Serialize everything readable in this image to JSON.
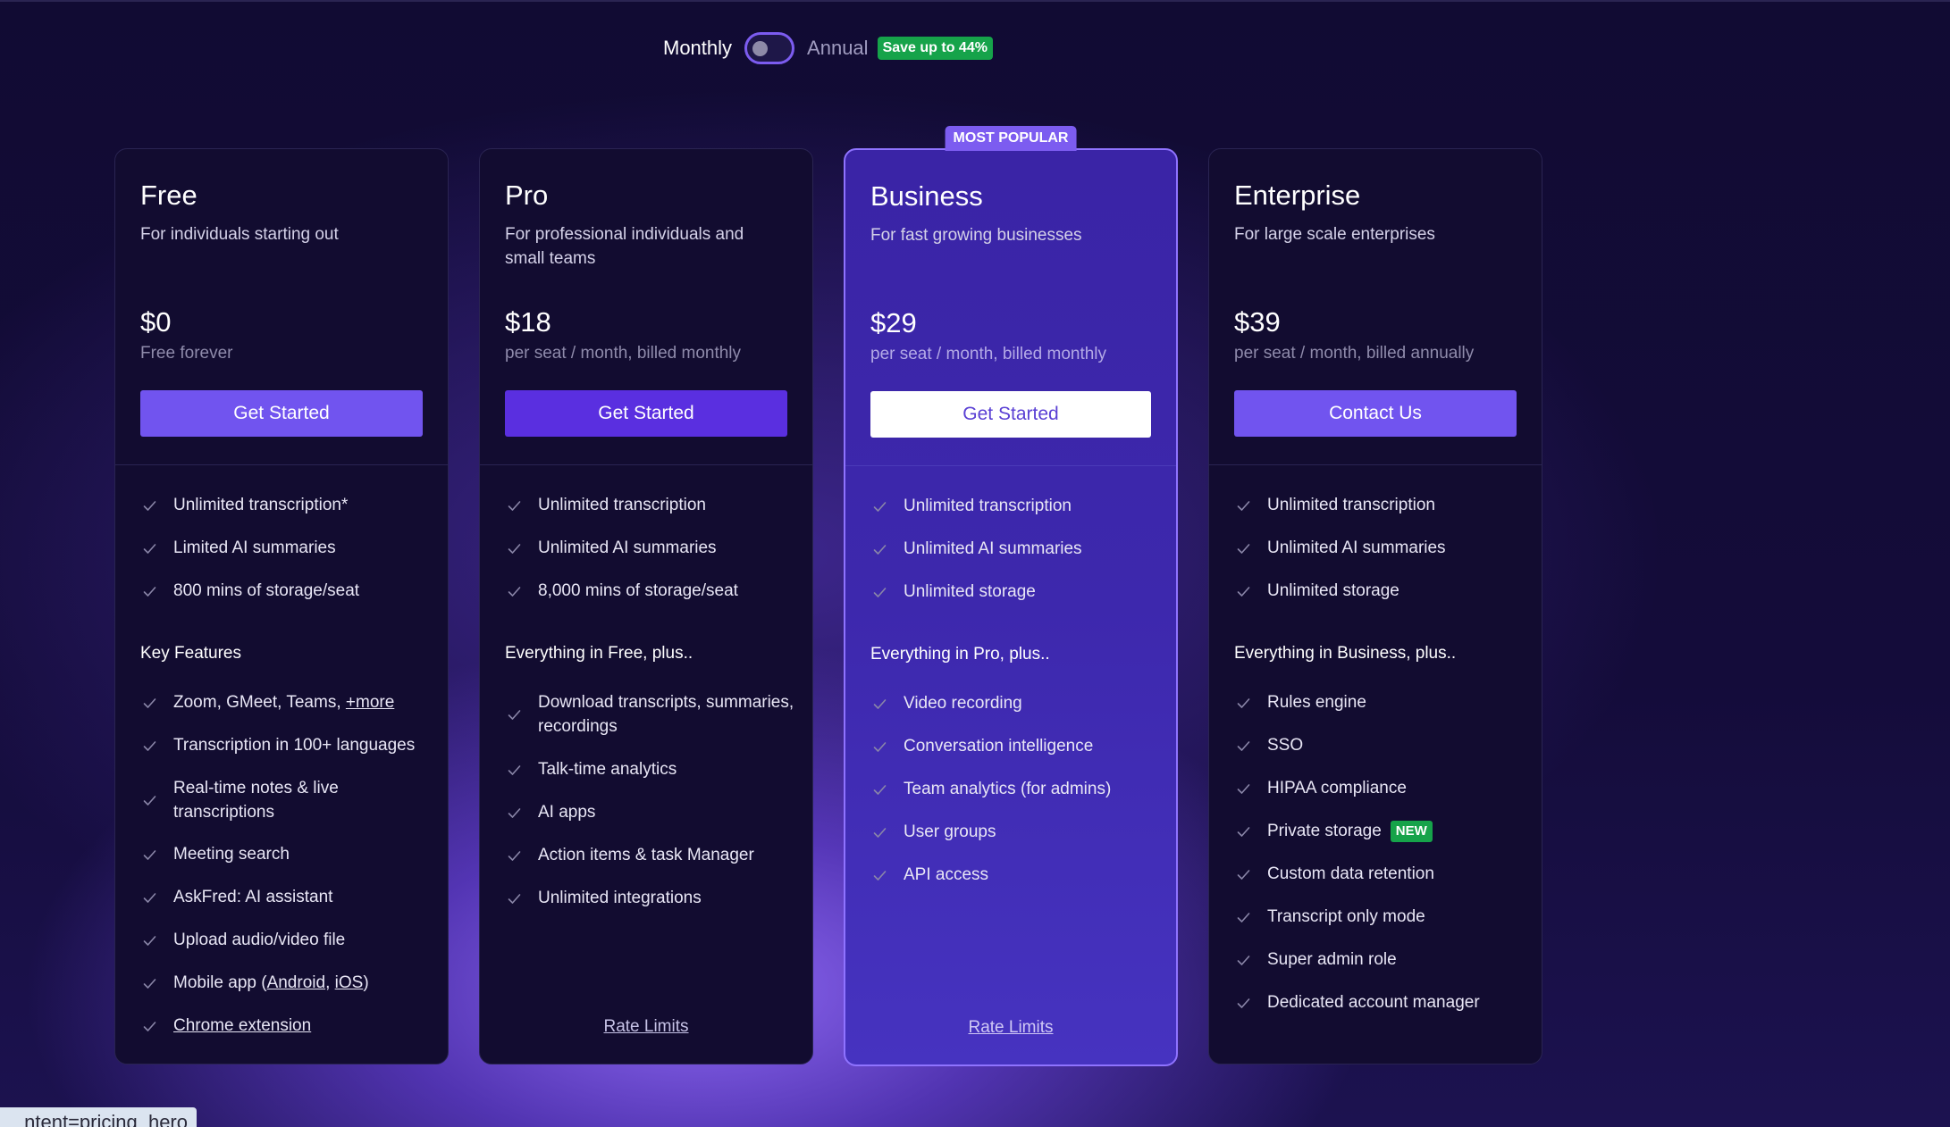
{
  "billing": {
    "monthly_label": "Monthly",
    "annual_label": "Annual",
    "save_badge": "Save up to 44%",
    "selected": "Monthly"
  },
  "plans": [
    {
      "name": "Free",
      "tagline": "For individuals starting out",
      "price": "$0",
      "period": "Free forever",
      "cta": "Get Started",
      "core": [
        "Unlimited transcription*",
        "Limited AI summaries",
        "800 mins of storage/seat"
      ],
      "group_title": "Key Features",
      "features": [
        "Zoom, GMeet, Teams, ",
        "Transcription in 100+ languages",
        "Real-time notes & live transcriptions",
        "Meeting search",
        "AskFred: AI assistant",
        "Upload audio/video file",
        "Mobile app (",
        ""
      ],
      "more_link": "+more",
      "android_link": "Android",
      "ios_link": "iOS",
      "mobile_sep": ", ",
      "mobile_close": ")",
      "chrome_link": "Chrome extension"
    },
    {
      "name": "Pro",
      "tagline": "For professional individuals and small teams",
      "price": "$18",
      "period": "per seat / month, billed monthly",
      "cta": "Get Started",
      "core": [
        "Unlimited transcription",
        "Unlimited AI summaries",
        "8,000 mins of storage/seat"
      ],
      "group_title": "Everything in Free, plus..",
      "features": [
        "Download transcripts, summaries, recordings",
        "Talk-time analytics",
        "AI apps",
        "Action items & task Manager",
        "Unlimited integrations"
      ],
      "footer_link": "Rate Limits"
    },
    {
      "name": "Business",
      "badge": "MOST POPULAR",
      "tagline": "For fast growing businesses",
      "price": "$29",
      "period": "per seat / month, billed monthly",
      "cta": "Get Started",
      "core": [
        "Unlimited transcription",
        "Unlimited AI summaries",
        "Unlimited storage"
      ],
      "group_title": "Everything in Pro, plus..",
      "features": [
        "Video recording",
        "Conversation intelligence",
        "Team analytics (for admins)",
        "User groups",
        "API access"
      ],
      "footer_link": "Rate Limits"
    },
    {
      "name": "Enterprise",
      "tagline": "For large scale enterprises",
      "price": "$39",
      "period": "per seat / month, billed annually",
      "cta": "Contact Us",
      "core": [
        "Unlimited transcription",
        "Unlimited AI summaries",
        "Unlimited storage"
      ],
      "group_title": "Everything in Business, plus..",
      "features": [
        "Rules engine",
        "SSO",
        "HIPAA compliance",
        "Private storage",
        "Custom data retention",
        "Transcript only mode",
        "Super admin role",
        "Dedicated account manager"
      ],
      "new_badge": "NEW"
    }
  ],
  "debug_tag": "ntent=pricing_hero",
  "colors": {
    "accent": "#7154ef",
    "accent_dark": "#5a2fe0",
    "featured_bg": "#3d28ad",
    "badge_green": "#16a34a",
    "page_bg": "#0f0a2e"
  }
}
